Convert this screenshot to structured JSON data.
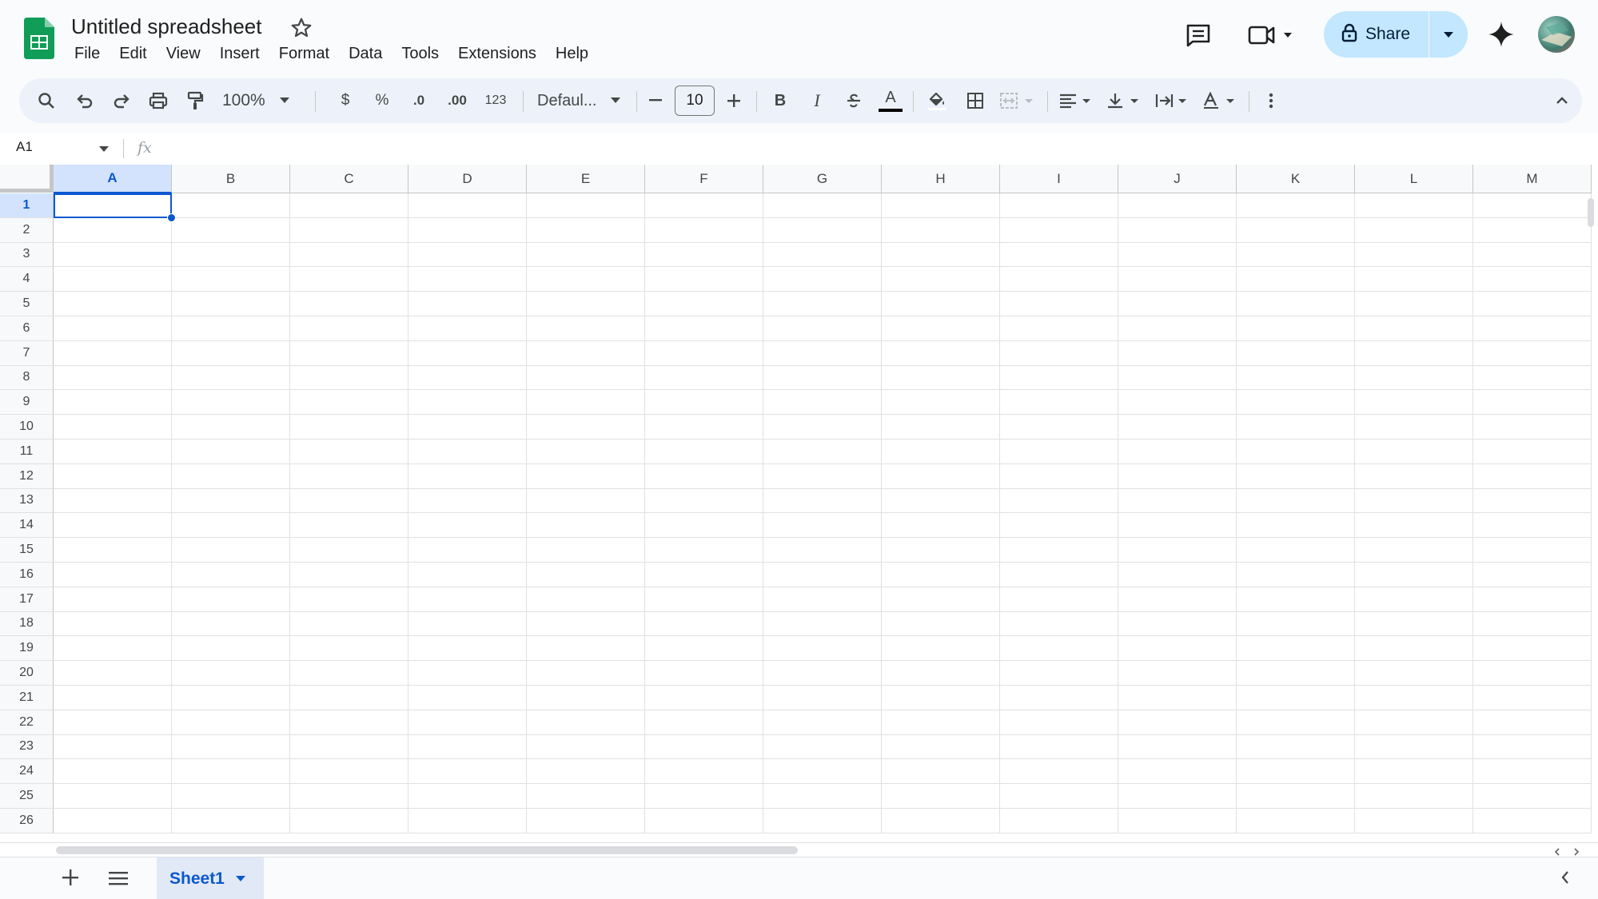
{
  "doc": {
    "title": "Untitled spreadsheet"
  },
  "menu": [
    "File",
    "Edit",
    "View",
    "Insert",
    "Format",
    "Data",
    "Tools",
    "Extensions",
    "Help"
  ],
  "share": {
    "label": "Share"
  },
  "toolbar": {
    "zoom": "100%",
    "currency": "$",
    "percent": "%",
    "decrease_decimal": ".0",
    "increase_decimal": ".00",
    "number_format": "123",
    "font": "Defaul...",
    "font_size": "10",
    "bold": "B",
    "italic": "I",
    "text_color_glyph": "A"
  },
  "formula_bar": {
    "name_box": "A1",
    "fx": "fx",
    "value": ""
  },
  "grid": {
    "columns": [
      "A",
      "B",
      "C",
      "D",
      "E",
      "F",
      "G",
      "H",
      "I",
      "J",
      "K",
      "L",
      "M"
    ],
    "rows": [
      "1",
      "2",
      "3",
      "4",
      "5",
      "6",
      "7",
      "8",
      "9",
      "10",
      "11",
      "12",
      "13",
      "14",
      "15",
      "16",
      "17",
      "18",
      "19",
      "20",
      "21",
      "22",
      "23",
      "24",
      "25",
      "26"
    ],
    "selected_cell": "A1"
  },
  "sheets": [
    {
      "name": "Sheet1",
      "active": true
    }
  ],
  "colors": {
    "accent": "#0b57d0",
    "share_bg": "#c2e7ff",
    "logo_green": "#0f9d58",
    "selection_bg": "#d3e3fd"
  }
}
